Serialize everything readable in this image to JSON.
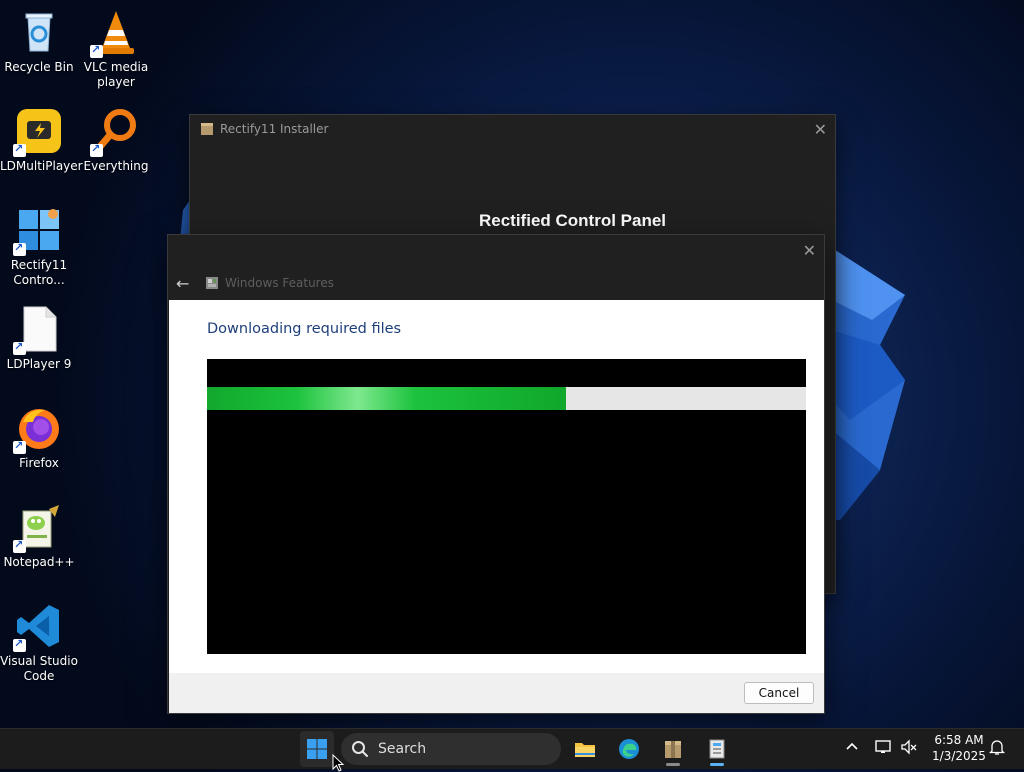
{
  "desktop": {
    "icons": [
      {
        "label": "Recycle Bin",
        "icon": "recycle-bin-icon"
      },
      {
        "label": "VLC media player",
        "icon": "vlc-icon"
      },
      {
        "label": "LDMultiPlayer",
        "icon": "ldmultiplayer-icon"
      },
      {
        "label": "Everything",
        "icon": "everything-search-icon"
      },
      {
        "label": "Rectify11 Contro...",
        "icon": "rectify11-control-icon"
      },
      {
        "label": "LDPlayer 9",
        "icon": "ldplayer-file-icon"
      },
      {
        "label": "Firefox",
        "icon": "firefox-icon"
      },
      {
        "label": "Notepad++",
        "icon": "notepadpp-icon"
      },
      {
        "label": "Visual Studio Code",
        "icon": "vscode-icon"
      }
    ]
  },
  "installer_window": {
    "title": "Rectify11 Installer",
    "heading": "Rectified Control Panel"
  },
  "features_dialog": {
    "nav_title": "Windows Features",
    "status": "Downloading required files",
    "progress": 0.6,
    "cancel_label": "Cancel"
  },
  "taskbar": {
    "search_placeholder": "Search",
    "time": "6:58 AM",
    "date": "1/3/2025",
    "pinned": [
      "file-explorer-icon",
      "edge-icon",
      "rectify11-installer-icon",
      "rectify11-control-icon"
    ]
  },
  "colors": {
    "progress_green": "#1cc23d",
    "status_text": "#1e3f7a"
  }
}
